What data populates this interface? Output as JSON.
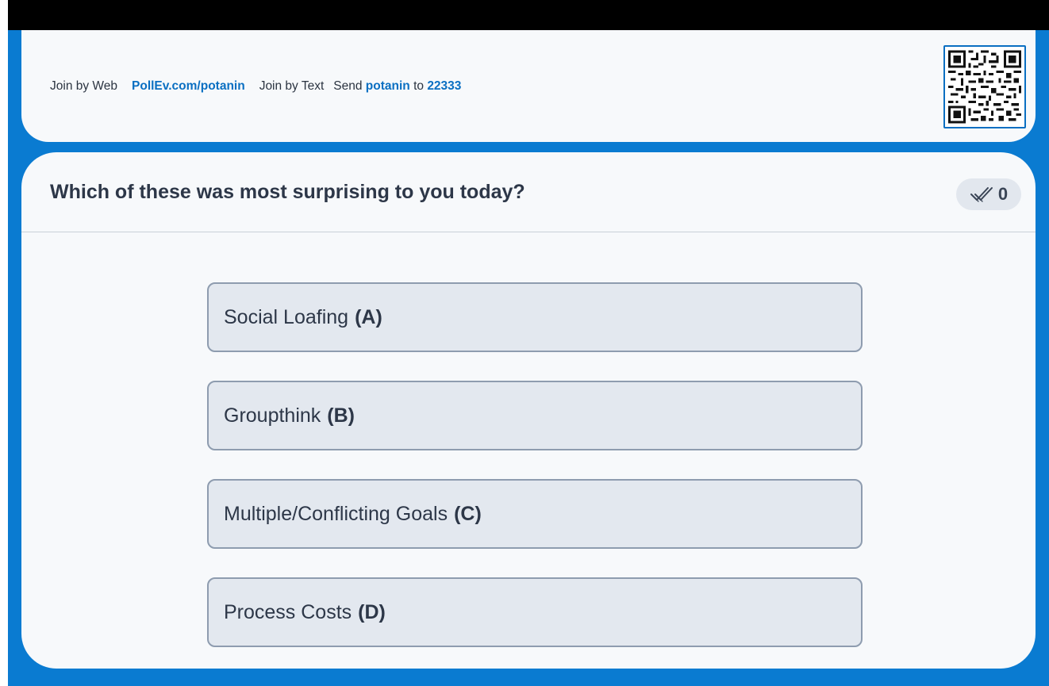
{
  "join": {
    "web_label": "Join by Web",
    "web_url": "PollEv.com/potanin",
    "text_label": "Join by Text",
    "send_word": "Send",
    "keyword": "potanin",
    "to_word": "to",
    "number": "22333"
  },
  "qr": {
    "icon": "qr-code"
  },
  "poll": {
    "question": "Which of these was most surprising to you today?",
    "response_count": "0",
    "response_icon": "double-check-icon",
    "options": [
      {
        "label": "Social Loafing",
        "letter": "(A)"
      },
      {
        "label": "Groupthink",
        "letter": "(B)"
      },
      {
        "label": "Multiple/Conflicting Goals",
        "letter": "(C)"
      },
      {
        "label": "Process Costs",
        "letter": "(D)"
      }
    ]
  },
  "colors": {
    "frame": "#0a7bd1",
    "card": "#f7f9fb",
    "link": "#0a6fc2",
    "option_bg": "#e3e8ef",
    "option_border": "#8e9caf"
  }
}
